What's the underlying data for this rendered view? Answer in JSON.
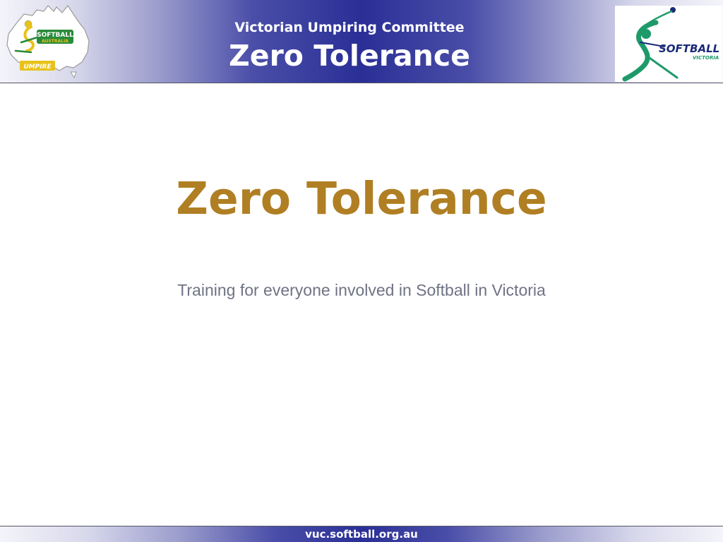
{
  "header": {
    "committee": "Victorian Umpiring Committee",
    "title": "Zero Tolerance",
    "logo_left": {
      "icon": "softball-australia-umpire-logo",
      "wordmark": "SOFTBALL",
      "sub_wordmark": "AUSTRALIA",
      "badge": "UMPIRE"
    },
    "logo_right": {
      "icon": "softball-victoria-logo",
      "wordmark": "SOFTBALL",
      "sub_wordmark": "VICTORIA"
    }
  },
  "main": {
    "title": "Zero Tolerance",
    "subtitle": "Training for everyone involved in Softball in Victoria"
  },
  "footer": {
    "url": "vuc.softball.org.au"
  },
  "colors": {
    "header_band_center": "#2a2f96",
    "title_gold": "#b07f23",
    "subtitle_gray": "#6f7384",
    "logo_green": "#1e9a6a",
    "logo_navy": "#1a2a78"
  }
}
